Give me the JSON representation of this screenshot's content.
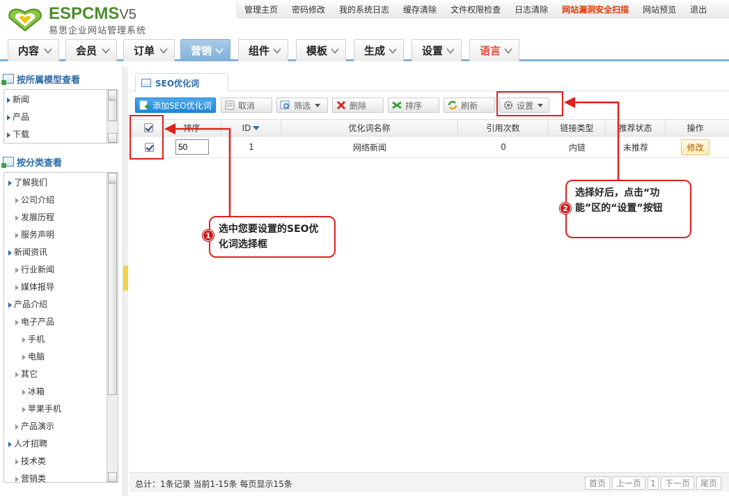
{
  "brand": {
    "logo_main": "ESPCMS",
    "logo_version": "V5",
    "subtitle": "易思企业网站管理系统"
  },
  "topnav": [
    {
      "label": "管理主页"
    },
    {
      "label": "密码修改"
    },
    {
      "label": "我的系统日志"
    },
    {
      "label": "缓存清除"
    },
    {
      "label": "文件权限检查"
    },
    {
      "label": "日志清除"
    },
    {
      "label": "网站漏洞安全扫描"
    },
    {
      "label": "网站预览"
    },
    {
      "label": "退出"
    }
  ],
  "menu": [
    {
      "label": "内容"
    },
    {
      "label": "会员"
    },
    {
      "label": "订单"
    },
    {
      "label": "营销"
    },
    {
      "label": "组件"
    },
    {
      "label": "模板"
    },
    {
      "label": "生成"
    },
    {
      "label": "设置"
    },
    {
      "label": "语言"
    }
  ],
  "sidebar": {
    "model_title": "按所属模型查看",
    "models": [
      {
        "label": "新闻"
      },
      {
        "label": "产品"
      },
      {
        "label": "下载"
      }
    ],
    "category_title": "按分类查看",
    "categories": [
      {
        "label": "了解我们"
      },
      {
        "label": "公司介绍"
      },
      {
        "label": "发展历程"
      },
      {
        "label": "服务声明"
      },
      {
        "label": "新闻资讯"
      },
      {
        "label": "行业新闻"
      },
      {
        "label": "媒体报导"
      },
      {
        "label": "产品介绍"
      },
      {
        "label": "电子产品"
      },
      {
        "label": "手机"
      },
      {
        "label": "电脑"
      },
      {
        "label": "其它"
      },
      {
        "label": "冰箱"
      },
      {
        "label": "苹果手机"
      },
      {
        "label": "产品演示"
      },
      {
        "label": "人才招聘"
      },
      {
        "label": "技术类"
      },
      {
        "label": "营销类"
      }
    ]
  },
  "tab": {
    "label": "SEO优化词"
  },
  "toolbar": {
    "add": "添加SEO优化词",
    "cancel": "取消",
    "filter": "筛选",
    "delete": "删除",
    "sort": "排序",
    "refresh": "刷新",
    "settings": "设置"
  },
  "table": {
    "headers": {
      "sort": "排序",
      "id": "ID",
      "name": "优化词名称",
      "count": "引用次数",
      "link_type": "链接类型",
      "recommend": "推荐状态",
      "action": "操作"
    },
    "rows": [
      {
        "sort": "50",
        "id": "1",
        "name": "网络新闻",
        "count": "0",
        "link_type": "内链",
        "recommend": "未推荐",
        "action": "修改"
      }
    ]
  },
  "footer": {
    "summary": "总计：1条记录 当前1-15条 每页显示15条",
    "first": "首页",
    "prev": "上一页",
    "page": "1",
    "next": "下一页",
    "last": "尾页"
  },
  "annotations": {
    "step1_num": "1",
    "step1_text": "选中您要设置的SEO优化词选择框",
    "step2_num": "2",
    "step2_text": "选择好后，点击“功能”区的“设置”按钮"
  },
  "colors": {
    "accent": "#7fb0d8",
    "annotation": "#e0201f",
    "brand_green": "#4a8d2a"
  }
}
